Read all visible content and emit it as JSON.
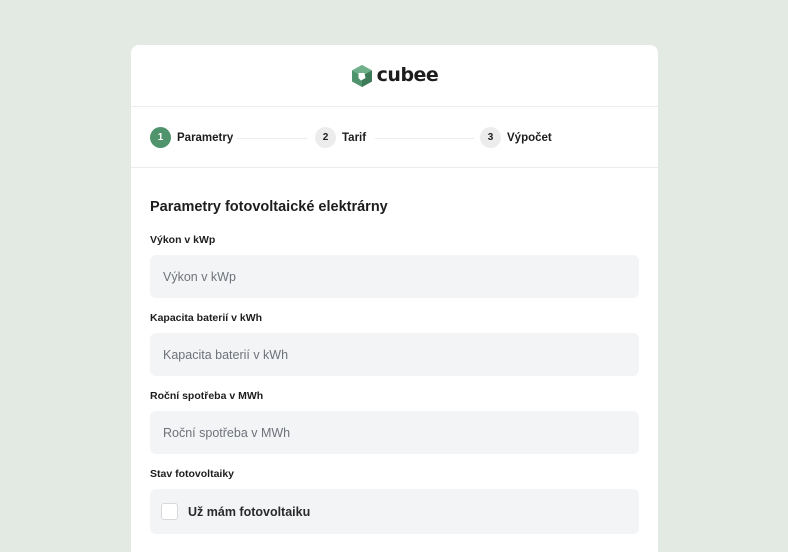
{
  "brand": {
    "name": "cubee",
    "accent_color": "#4f946d"
  },
  "stepper": {
    "steps": [
      {
        "number": "1",
        "label": "Parametry",
        "active": true
      },
      {
        "number": "2",
        "label": "Tarif",
        "active": false
      },
      {
        "number": "3",
        "label": "Výpočet",
        "active": false
      }
    ]
  },
  "form": {
    "title": "Parametry fotovoltaické elektrárny",
    "fields": [
      {
        "label": "Výkon v kWp",
        "placeholder": "Výkon v kWp",
        "value": ""
      },
      {
        "label": "Kapacita baterií v kWh",
        "placeholder": "Kapacita baterií v kWh",
        "value": ""
      },
      {
        "label": "Roční spotřeba v MWh",
        "placeholder": "Roční spotřeba v MWh",
        "value": ""
      }
    ],
    "status": {
      "label": "Stav fotovoltaiky",
      "checkbox_label": "Už mám fotovoltaiku",
      "checked": false
    }
  }
}
